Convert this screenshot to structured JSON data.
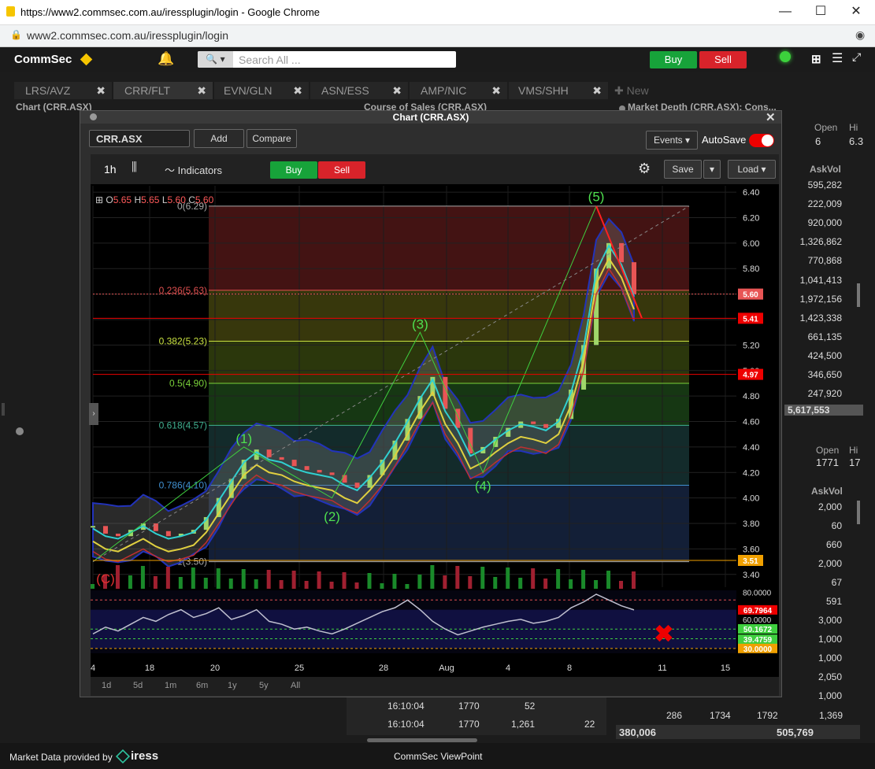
{
  "browser": {
    "url_title": "https://www2.commsec.com.au/iressplugin/login - Google Chrome",
    "address": "www2.commsec.com.au/iressplugin/login"
  },
  "app": {
    "logo": "CommSec",
    "search_placeholder": "Search All ...",
    "buy": "Buy",
    "sell": "Sell"
  },
  "tabs": [
    "LRS/AVZ",
    "CRR/FLT",
    "EVN/GLN",
    "ASN/ESS",
    "AMP/NIC",
    "VMS/SHH",
    "New"
  ],
  "panels": {
    "chart": "Chart (CRR.ASX)",
    "cos": "Course of Sales (CRR.ASX)",
    "depth": "Market Depth (CRR.ASX): Cons..."
  },
  "chart_window": {
    "title": "Chart (CRR.ASX)",
    "symbol": "CRR.ASX",
    "add": "Add",
    "compare": "Compare",
    "events": "Events",
    "autosave": "AutoSave",
    "interval": "1h",
    "indicators": "Indicators",
    "buy": "Buy",
    "sell": "Sell",
    "save": "Save",
    "load": "Load",
    "ohlc": {
      "o_label": "O",
      "o": "5.65",
      "h_label": "H",
      "h": "5.65",
      "l_label": "L",
      "l": "5.60",
      "c_label": "C",
      "c": "5.60"
    },
    "ranges": [
      "1d",
      "5d",
      "1m",
      "6m",
      "1y",
      "5y",
      "All"
    ],
    "fib_labels": [
      "0(6.29)",
      "0.236(5.63)",
      "0.382(5.23)",
      "0.5(4.90)",
      "0.618(4.57)",
      "0.786(4.10)",
      "1(3.50)"
    ],
    "wave_labels": [
      "(1)",
      "(2)",
      "(3)",
      "(4)",
      "(5)",
      "(C)"
    ],
    "price_badges": [
      "5.60",
      "5.41",
      "4.97",
      "3.51"
    ],
    "osc_badges": [
      "69.7964",
      "50.1672",
      "39.4759",
      "30.0000"
    ],
    "osc_axis": [
      "80.0000",
      "60.0000"
    ]
  },
  "chart_data": {
    "type": "line",
    "title": "",
    "xlabel": "",
    "ylabel": "",
    "x_ticks": [
      "4",
      "18",
      "20",
      "25",
      "28",
      "Aug",
      "4",
      "8",
      "11",
      "15"
    ],
    "y_ticks": [
      "6.40",
      "6.20",
      "6.00",
      "5.80",
      "5.60",
      "5.40",
      "5.20",
      "5.00",
      "4.80",
      "4.60",
      "4.40",
      "4.20",
      "4.00",
      "3.80",
      "3.60",
      "3.40"
    ],
    "ylim": [
      3.3,
      6.45
    ],
    "series": [
      {
        "values": [
          3.78,
          3.72,
          3.7,
          3.75,
          3.8,
          3.74,
          3.7,
          3.72,
          3.75,
          3.85,
          4.0,
          4.15,
          4.3,
          4.38,
          4.32,
          4.3,
          4.25,
          4.22,
          4.2,
          4.18,
          4.12,
          4.08,
          4.18,
          4.3,
          4.45,
          4.62,
          4.8,
          4.95,
          4.7,
          4.55,
          4.35,
          4.4,
          4.48,
          4.55,
          4.6,
          4.58,
          4.55,
          4.62,
          4.85,
          5.2,
          5.8,
          6.0,
          5.85,
          5.6
        ]
      }
    ],
    "oscillator": {
      "type": "line",
      "ylim": [
        25,
        90
      ],
      "values": [
        45,
        52,
        48,
        55,
        62,
        58,
        65,
        70,
        62,
        66,
        72,
        60,
        64,
        70,
        58,
        55,
        50,
        52,
        48,
        45,
        50,
        56,
        62,
        68,
        72,
        80,
        70,
        58,
        50,
        44,
        48,
        52,
        55,
        58,
        60,
        56,
        58,
        62,
        72,
        78,
        86,
        80,
        74,
        69.8
      ]
    },
    "legend": "none",
    "grid": true
  },
  "right_panel": {
    "open_label": "Open",
    "open_value": "6",
    "hi_label": "Hi",
    "hi_value": "6.3",
    "askvol_label": "AskVol",
    "askvol": [
      "595,282",
      "222,009",
      "920,000",
      "1,326,862",
      "770,868",
      "1,041,413",
      "1,972,156",
      "1,423,338",
      "661,135",
      "424,500",
      "346,650",
      "247,920"
    ],
    "askvol_total": "5,617,553",
    "open2_label": "Open",
    "open2_value": "1771",
    "hi2_label": "Hi",
    "hi2_value": "17",
    "askvol2": [
      "2,000",
      "60",
      "660",
      "2,000",
      "67",
      "591",
      "3,000",
      "1,000",
      "1,000",
      "2,050",
      "1,000",
      "1,369"
    ],
    "bottom_row": [
      "286",
      "1734",
      "1792"
    ],
    "bottom_totals": [
      "380,006",
      "505,769"
    ]
  },
  "cos_rows": [
    {
      "time": "16:10:04",
      "price": "1770",
      "vol": "52"
    },
    {
      "time": "16:10:04",
      "price": "1770",
      "vol": "1,261",
      "extra": "22"
    }
  ],
  "footer": {
    "provided": "Market Data provided by",
    "brand": "iress",
    "center": "CommSec ViewPoint"
  },
  "colors": {
    "buy": "#17a33a",
    "sell": "#d8232a",
    "accent": "#f6c500"
  }
}
